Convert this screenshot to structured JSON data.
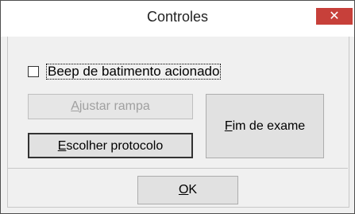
{
  "window": {
    "title": "Controles",
    "close_glyph": "✕"
  },
  "checkbox": {
    "label": "Beep de batimento acionado",
    "checked": false
  },
  "buttons": {
    "ajustar_rampa": {
      "mnemonic": "A",
      "rest": "justar rampa",
      "enabled": false
    },
    "escolher_protocolo": {
      "mnemonic": "E",
      "rest": "scolher protocolo",
      "enabled": true
    },
    "fim_de_exame": {
      "mnemonic": "F",
      "rest": "im de exame",
      "enabled": true
    },
    "ok": {
      "mnemonic": "O",
      "rest": "K",
      "enabled": true
    }
  },
  "colors": {
    "close_button": "#c7403a",
    "window_bg": "#f0f0f0",
    "disabled_text": "#a0a0a0"
  }
}
